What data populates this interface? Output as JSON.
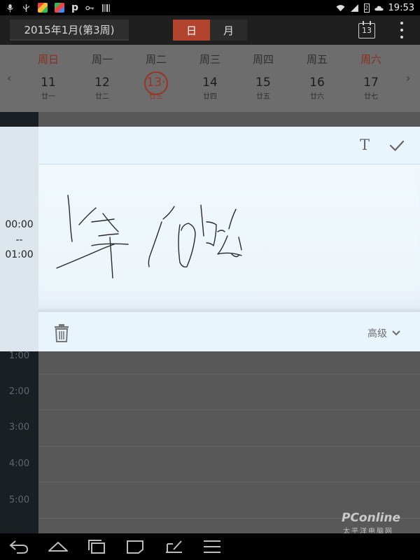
{
  "status_bar": {
    "time": "19:53",
    "battery": "2",
    "left_icons": [
      "microphone-icon",
      "usb-icon",
      "app-icon",
      "app-icon",
      "p-icon",
      "key-icon",
      "barcode-icon"
    ],
    "right_icons": [
      "wifi-icon",
      "signal-icon",
      "battery-icon",
      "cloud-icon"
    ]
  },
  "app_bar": {
    "date_range": "2015年1月(第3周)",
    "view_day": "日",
    "view_month": "月",
    "today_number": "13",
    "accent_color": "#b2432f"
  },
  "week": {
    "days": [
      {
        "name": "周日",
        "num": "11",
        "lunar": "廿一",
        "weekend": true,
        "today": false
      },
      {
        "name": "周一",
        "num": "12",
        "lunar": "廿二",
        "weekend": false,
        "today": false
      },
      {
        "name": "周二",
        "num": "13·",
        "lunar": "廿三",
        "weekend": false,
        "today": true
      },
      {
        "name": "周三",
        "num": "14",
        "lunar": "廿四",
        "weekend": false,
        "today": false
      },
      {
        "name": "周四",
        "num": "15",
        "lunar": "廿五",
        "weekend": false,
        "today": false
      },
      {
        "name": "周五",
        "num": "16",
        "lunar": "廿六",
        "weekend": false,
        "today": false
      },
      {
        "name": "周六",
        "num": "17",
        "lunar": "廿七",
        "weekend": true,
        "today": false
      }
    ]
  },
  "event": {
    "start": "00:00",
    "separator": "--",
    "end": "01:00",
    "advanced_label": "高级"
  },
  "timeline": {
    "hours": [
      "1:00",
      "2:00",
      "3:00",
      "4:00",
      "5:00"
    ]
  },
  "watermark": {
    "brand": "PConline",
    "sub": "太平洋电脑网"
  }
}
